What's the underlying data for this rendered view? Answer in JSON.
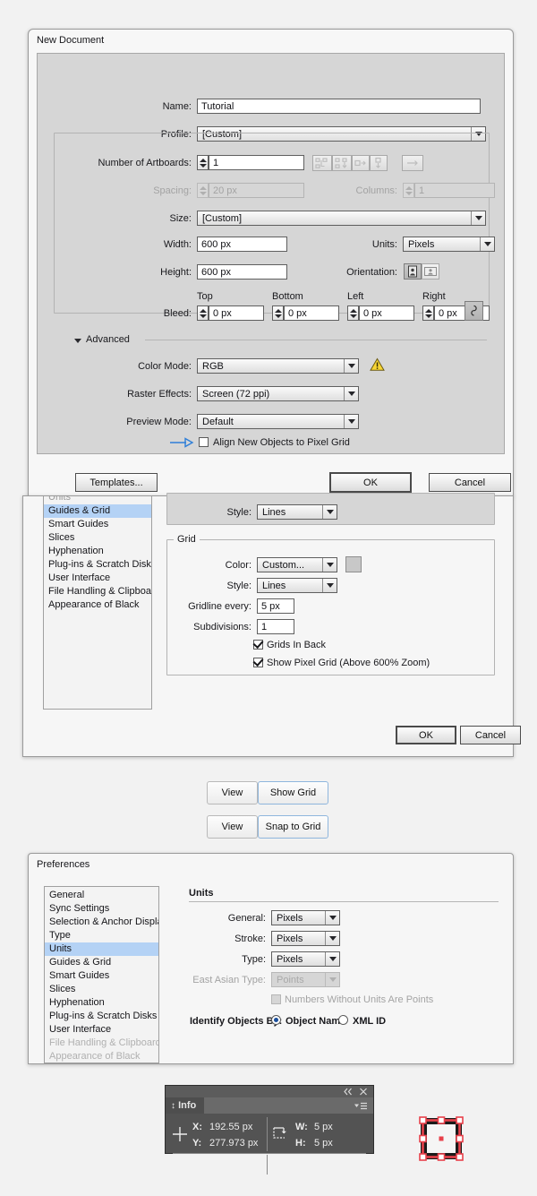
{
  "new_document": {
    "title": "New Document",
    "fields": {
      "name_label": "Name:",
      "name_value": "Tutorial",
      "profile_label": "Profile:",
      "profile_value": "[Custom]",
      "artboards_label": "Number of Artboards:",
      "artboards_value": "1",
      "spacing_label": "Spacing:",
      "spacing_value": "20 px",
      "columns_label": "Columns:",
      "columns_value": "1",
      "size_label": "Size:",
      "size_value": "[Custom]",
      "width_label": "Width:",
      "width_value": "600 px",
      "units_label": "Units:",
      "units_value": "Pixels",
      "height_label": "Height:",
      "height_value": "600 px",
      "orientation_label": "Orientation:",
      "bleed_label": "Bleed:",
      "bleed_top_label": "Top",
      "bleed_top_value": "0 px",
      "bleed_bottom_label": "Bottom",
      "bleed_bottom_value": "0 px",
      "bleed_left_label": "Left",
      "bleed_left_value": "0 px",
      "bleed_right_label": "Right",
      "bleed_right_value": "0 px"
    },
    "advanced": {
      "section_label": "Advanced",
      "color_mode_label": "Color Mode:",
      "color_mode_value": "RGB",
      "raster_label": "Raster Effects:",
      "raster_value": "Screen (72 ppi)",
      "preview_label": "Preview Mode:",
      "preview_value": "Default",
      "align_pixel_label": "Align New Objects to Pixel Grid",
      "align_pixel_checked": false,
      "warning_icon": "warning-triangle-icon"
    },
    "buttons": {
      "templates": "Templates...",
      "ok": "OK",
      "cancel": "Cancel"
    }
  },
  "prefs_grid": {
    "sidebar": [
      "Units",
      "Guides & Grid",
      "Smart Guides",
      "Slices",
      "Hyphenation",
      "Plug-ins & Scratch Disks",
      "User Interface",
      "File Handling & Clipboard",
      "Appearance of Black"
    ],
    "sidebar_selected": "Guides & Grid",
    "guides_style_label": "Style:",
    "guides_style_value": "Lines",
    "grid_group_label": "Grid",
    "color_label": "Color:",
    "color_value": "Custom...",
    "color_swatch": "#c8c8c8",
    "style_label": "Style:",
    "style_value": "Lines",
    "gridline_label": "Gridline every:",
    "gridline_value": "5 px",
    "subdivisions_label": "Subdivisions:",
    "subdivisions_value": "1",
    "grids_in_back_label": "Grids In Back",
    "grids_in_back_checked": true,
    "show_pixel_grid_label": "Show Pixel Grid (Above 600% Zoom)",
    "show_pixel_grid_checked": true,
    "ok": "OK",
    "cancel": "Cancel"
  },
  "menu_paths": [
    {
      "menu": "View",
      "item": "Show Grid"
    },
    {
      "menu": "View",
      "item": "Snap to Grid"
    }
  ],
  "prefs_units": {
    "title": "Preferences",
    "sidebar": [
      "General",
      "Sync Settings",
      "Selection & Anchor Display",
      "Type",
      "Units",
      "Guides & Grid",
      "Smart Guides",
      "Slices",
      "Hyphenation",
      "Plug-ins & Scratch Disks",
      "User Interface",
      "File Handling & Clipboard",
      "Appearance of Black"
    ],
    "sidebar_selected": "Units",
    "section_label": "Units",
    "general_label": "General:",
    "general_value": "Pixels",
    "stroke_label": "Stroke:",
    "stroke_value": "Pixels",
    "type_label": "Type:",
    "type_value": "Pixels",
    "east_asian_label": "East Asian Type:",
    "east_asian_value": "Points",
    "numbers_label": "Numbers Without Units Are Points",
    "numbers_checked": false,
    "identify_label": "Identify Objects By:",
    "identify_option_1": "Object Name",
    "identify_option_2": "XML ID",
    "identify_selected": "Object Name"
  },
  "info_panel": {
    "tab_label": "Info",
    "collapse_icon": "double-chevron-left-icon",
    "close_icon": "close-icon",
    "menu_icon": "panel-menu-icon",
    "x_label": "X:",
    "x_value": "192.55 px",
    "y_label": "Y:",
    "y_value": "277.973 px",
    "w_label": "W:",
    "w_value": "5 px",
    "h_label": "H:",
    "h_value": "5 px",
    "position_icon": "crosshair-icon",
    "size_icon": "bounding-box-icon"
  },
  "artwork": {
    "name": "selected-square-artwork",
    "accent_color": "#e8404a",
    "fill_color": "#1a1a1a"
  }
}
